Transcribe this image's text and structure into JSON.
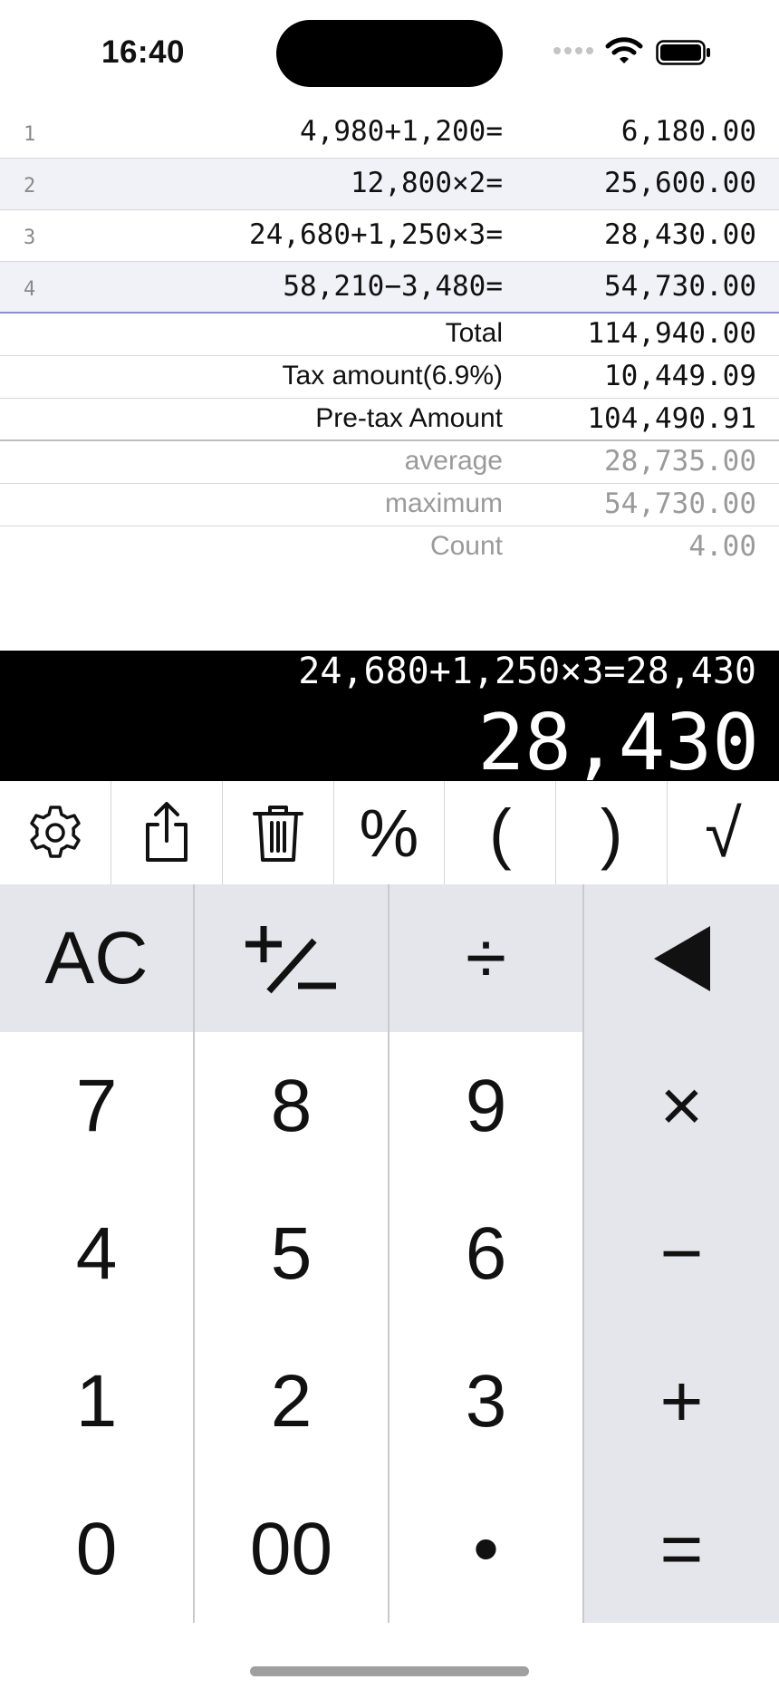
{
  "status_bar": {
    "time": "16:40"
  },
  "tape": {
    "rows": [
      {
        "index": "1",
        "expression": "4,980+1,200=",
        "result": "6,180.00"
      },
      {
        "index": "2",
        "expression": "12,800×2=",
        "result": "25,600.00"
      },
      {
        "index": "3",
        "expression": "24,680+1,250×3=",
        "result": "28,430.00"
      },
      {
        "index": "4",
        "expression": "58,210−3,480=",
        "result": "54,730.00"
      }
    ],
    "summary": [
      {
        "label": "Total",
        "value": "114,940.00"
      },
      {
        "label": "Tax amount(6.9%)",
        "value": "10,449.09"
      },
      {
        "label": "Pre-tax Amount",
        "value": "104,490.91"
      }
    ],
    "stats": [
      {
        "label": "average",
        "value": "28,735.00"
      },
      {
        "label": "maximum",
        "value": "54,730.00"
      },
      {
        "label": "Count",
        "value": "4.00"
      }
    ]
  },
  "display": {
    "expression": "24,680+1,250×3=28,430",
    "value": "28,430"
  },
  "function_row": {
    "settings_icon": "gear-icon",
    "share_icon": "share-icon",
    "delete_icon": "trash-icon",
    "percent": "%",
    "open_paren": "(",
    "close_paren": ")",
    "sqrt": "√"
  },
  "keypad": {
    "clear": "AC",
    "sign_icon": "plus-minus-icon",
    "divide": "÷",
    "backspace_icon": "backspace-triangle-icon",
    "seven": "7",
    "eight": "8",
    "nine": "9",
    "multiply": "×",
    "four": "4",
    "five": "5",
    "six": "6",
    "minus": "−",
    "one": "1",
    "two": "2",
    "three": "3",
    "plus": "+",
    "zero": "0",
    "double_zero": "00",
    "decimal": "•",
    "equals": "="
  },
  "colors": {
    "display_bg": "#000000",
    "tape_alt_row": "#f1f1f8",
    "operator_key_bg": "#e5e5ec",
    "accent_line": "#8b8bd6"
  }
}
